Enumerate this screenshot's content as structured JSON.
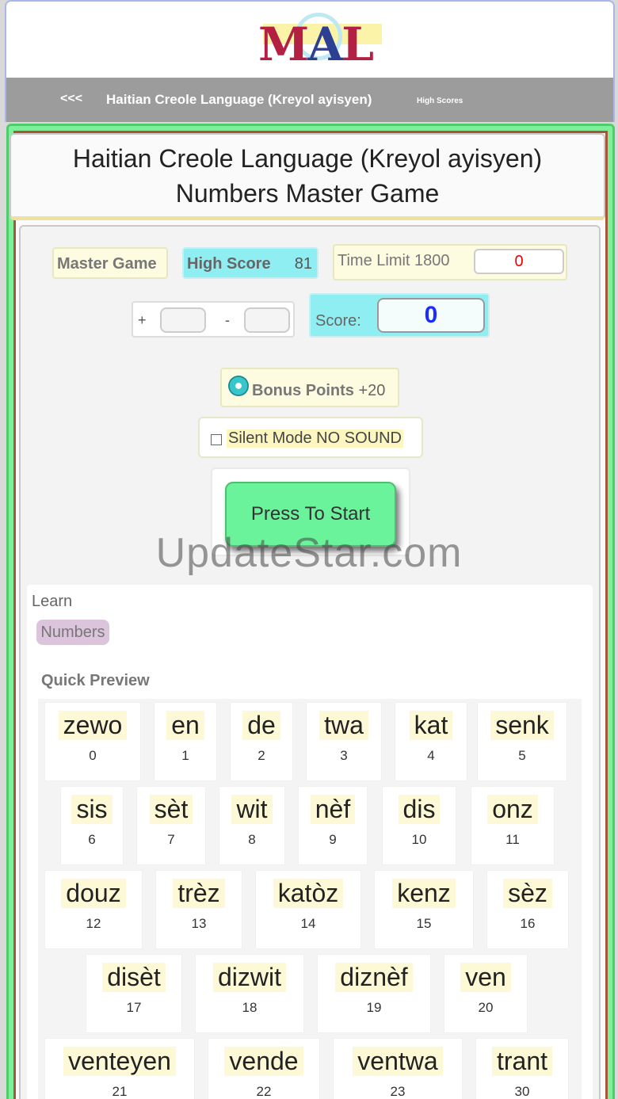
{
  "logo": {
    "text_m": "M",
    "text_a": "A",
    "text_l": "L"
  },
  "nav": {
    "back": "<<<",
    "crumb": "Haitian Creole Language (Kreyol ayisyen)",
    "high_scores": "High Scores"
  },
  "title": {
    "line1": "Haitian Creole Language (Kreyol ayisyen)",
    "line2": "Numbers Master Game"
  },
  "stats": {
    "master_game": "Master Game",
    "high_score_label": "High Score",
    "high_score_value": "81",
    "time_limit_label": "Time Limit 1800",
    "time_value": "0",
    "plus": "+",
    "minus": "-",
    "score_label": "Score:",
    "score_value": "0"
  },
  "bonus": {
    "label": "Bonus Points",
    "value": "+20"
  },
  "silent": {
    "label": "Silent Mode NO SOUND"
  },
  "start": {
    "label": "Press To Start"
  },
  "watermark": "UpdateStar.com",
  "learn": {
    "label": "Learn",
    "tag": "Numbers",
    "preview": "Quick Preview"
  },
  "cards": [
    {
      "word": "zewo",
      "num": "0"
    },
    {
      "word": "en",
      "num": "1"
    },
    {
      "word": "de",
      "num": "2"
    },
    {
      "word": "twa",
      "num": "3"
    },
    {
      "word": "kat",
      "num": "4"
    },
    {
      "word": "senk",
      "num": "5"
    },
    {
      "word": "sis",
      "num": "6"
    },
    {
      "word": "sèt",
      "num": "7"
    },
    {
      "word": "wit",
      "num": "8"
    },
    {
      "word": "nèf",
      "num": "9"
    },
    {
      "word": "dis",
      "num": "10"
    },
    {
      "word": "onz",
      "num": "11"
    },
    {
      "word": "douz",
      "num": "12"
    },
    {
      "word": "trèz",
      "num": "13"
    },
    {
      "word": "katòz",
      "num": "14"
    },
    {
      "word": "kenz",
      "num": "15"
    },
    {
      "word": "sèz",
      "num": "16"
    },
    {
      "word": "disèt",
      "num": "17"
    },
    {
      "word": "dizwit",
      "num": "18"
    },
    {
      "word": "diznèf",
      "num": "19"
    },
    {
      "word": "ven",
      "num": "20"
    },
    {
      "word": "venteyen",
      "num": "21"
    },
    {
      "word": "vende",
      "num": "22"
    },
    {
      "word": "ventwa",
      "num": "23"
    },
    {
      "word": "trant",
      "num": "30"
    }
  ]
}
